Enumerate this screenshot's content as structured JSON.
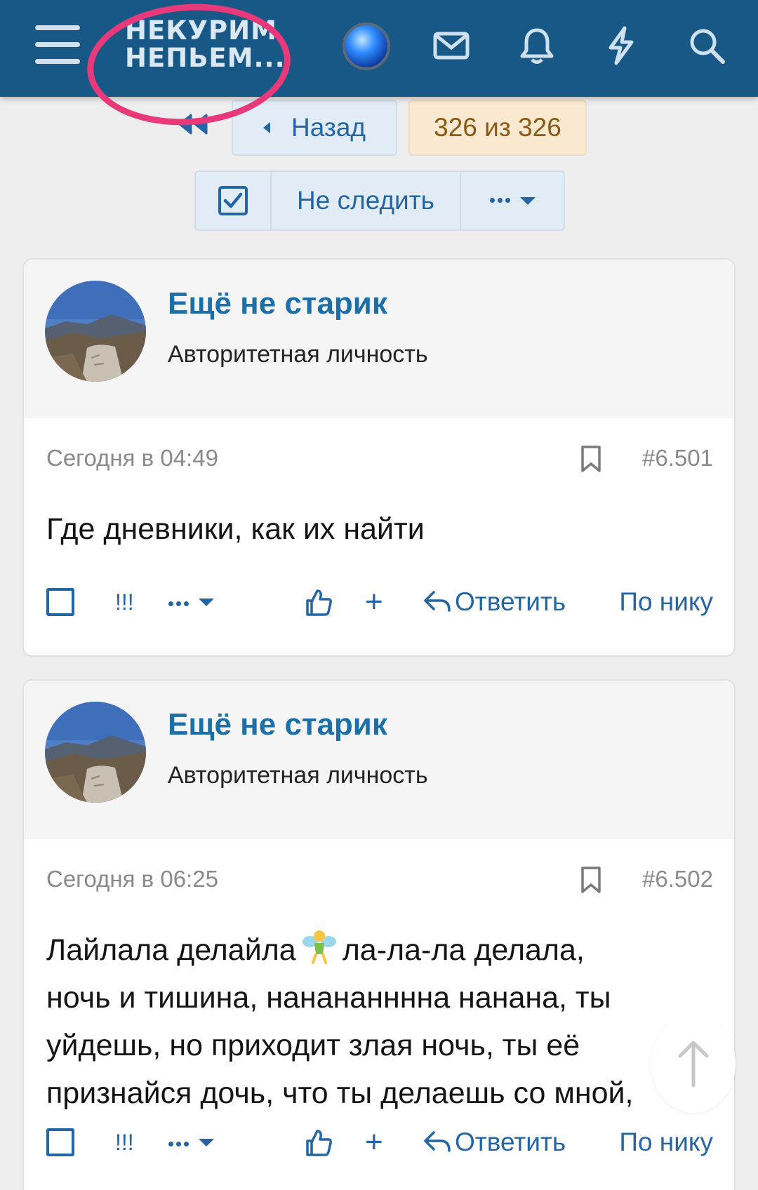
{
  "header": {
    "logo_line1": "НЕКУРИМ",
    "logo_line2": "НЕПЬЕМ...",
    "icons": [
      "menu-icon",
      "status-orb-icon",
      "mail-icon",
      "bell-icon",
      "lightning-icon",
      "search-icon"
    ],
    "bg_color": "#185886",
    "highlight_color": "#e8397a"
  },
  "nav": {
    "back_label": "Назад",
    "page_counter": "326 из 326",
    "unwatch_label": "Не следить"
  },
  "posts": [
    {
      "author": "Ещё не старик",
      "user_title": "Авторитетная личность",
      "date": "Сегодня в 04:49",
      "number": "#6.501",
      "text_lines": [
        "Где дневники, как их найти"
      ]
    },
    {
      "author": "Ещё не старик",
      "user_title": "Авторитетная личность",
      "date": "Сегодня в 06:25",
      "number": "#6.502",
      "text_line1_a": "Лайлала делайла",
      "text_line1_b": "ла-ла-ла делала,",
      "text_lines": [
        "ночь и тишина, нанананннна нанана, ты",
        "уйдешь, но приходит злая ночь, ты её",
        "признайся дочь, что ты делаешь со мной,"
      ]
    }
  ],
  "actions": {
    "exclaim": "!!!",
    "plus": "+",
    "reply": "Ответить",
    "by_nick": "По нику"
  },
  "accent_color": "#2466a3"
}
